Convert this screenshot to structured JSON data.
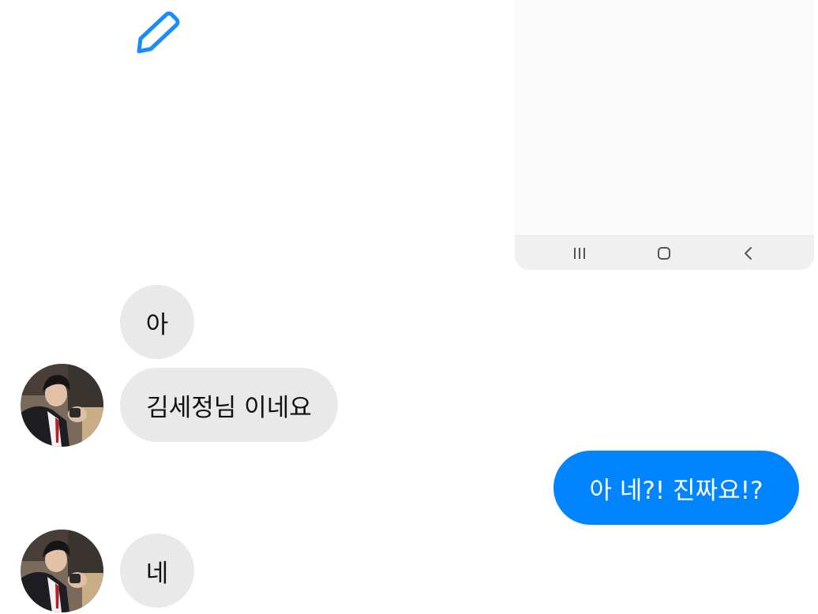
{
  "toolbar": {
    "edit_icon": "pencil-icon",
    "accent_color": "#1a8cff"
  },
  "system_nav": {
    "recent_icon": "recent-apps-icon",
    "home_icon": "home-icon",
    "back_icon": "back-chevron-icon"
  },
  "messages": [
    {
      "direction": "incoming",
      "text": "아"
    },
    {
      "direction": "incoming",
      "text": "김세정님 이네요"
    },
    {
      "direction": "outgoing",
      "text": "아 네?! 진짜요!?"
    },
    {
      "direction": "incoming",
      "text": "네"
    }
  ],
  "colors": {
    "incoming_bubble": "#e9e9e9",
    "outgoing_bubble": "#0084ff",
    "incoming_text": "#111111",
    "outgoing_text": "#ffffff"
  }
}
